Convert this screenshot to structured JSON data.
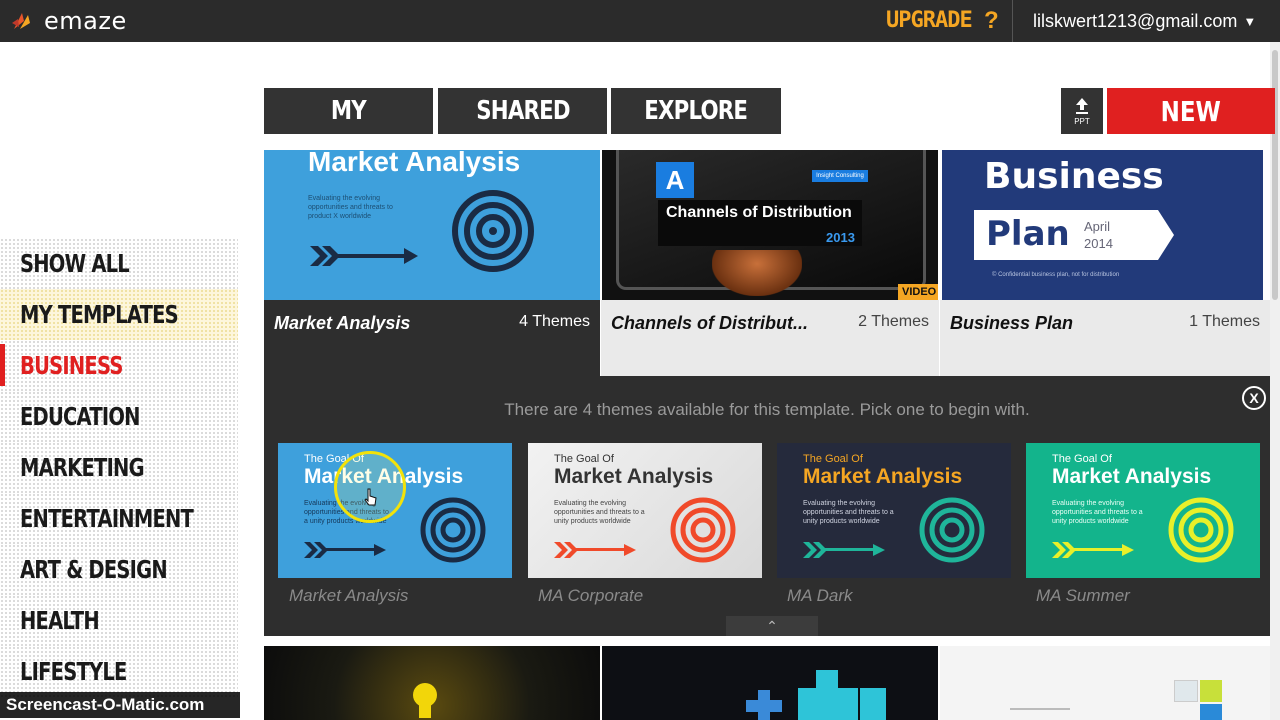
{
  "app": {
    "name": "emaze"
  },
  "topbar": {
    "upgrade_label": "UPGRADE",
    "help_label": "?",
    "user_email": "lilskwert1213@gmail.com",
    "caret": "▼"
  },
  "tabs": [
    {
      "label": "MY"
    },
    {
      "label": "SHARED"
    },
    {
      "label": "EXPLORE"
    }
  ],
  "toolbar": {
    "ppt_label": "PPT",
    "new_label": "NEW"
  },
  "sidebar": {
    "items": [
      {
        "label": "SHOW ALL",
        "state": "normal"
      },
      {
        "label": "MY TEMPLATES",
        "state": "highlight"
      },
      {
        "label": "BUSINESS",
        "state": "active"
      },
      {
        "label": "EDUCATION",
        "state": "normal"
      },
      {
        "label": "MARKETING",
        "state": "normal"
      },
      {
        "label": "ENTERTAINMENT",
        "state": "normal"
      },
      {
        "label": "ART & DESIGN",
        "state": "normal"
      },
      {
        "label": "HEALTH",
        "state": "normal"
      },
      {
        "label": "LIFESTYLE",
        "state": "normal"
      }
    ]
  },
  "templates": [
    {
      "title": "Market Analysis",
      "themes": "4 Themes",
      "thumb_title": "Market Analysis",
      "thumb_sub": "Evaluating the evolving opportunities and threats to product X worldwide"
    },
    {
      "title": "Channels of Distribut...",
      "themes": "2 Themes",
      "badge_letter": "A",
      "thumb_title": "Channels of Distribution",
      "thumb_year": "2013",
      "thumb_tag": "Insight Consulting",
      "video_badge": "VIDEO"
    },
    {
      "title": "Business Plan",
      "themes": "1 Themes",
      "thumb_line1": "Business",
      "thumb_line2": "Plan",
      "thumb_date": "April\n2014",
      "thumb_footer": "© Confidential business plan, not for distribution"
    }
  ],
  "theme_panel": {
    "message": "There are 4 themes available for this template. Pick one to begin with.",
    "close_label": "X",
    "collapse_label": "⌃",
    "themes": [
      {
        "name": "Market Analysis",
        "kicker": "The Goal Of",
        "title": "Market Analysis",
        "sub": "Evaluating the evolving opportunities and threats to a unity products worldwide"
      },
      {
        "name": "MA Corporate",
        "kicker": "The Goal Of",
        "title": "Market Analysis",
        "sub": "Evaluating the evolving opportunities and threats to a unity products worldwide"
      },
      {
        "name": "MA Dark",
        "kicker": "The Goal Of",
        "title": "Market Analysis",
        "sub": "Evaluating the evolving opportunities and threats to a unity products worldwide"
      },
      {
        "name": "MA Summer",
        "kicker": "The Goal Of",
        "title": "Market Analysis",
        "sub": "Evaluating the evolving opportunities and threats to a unity products worldwide"
      }
    ]
  },
  "watermark": "Screencast-O-Matic.com",
  "colors": {
    "accent_red": "#e02020",
    "upgrade_orange": "#f5a623",
    "dark_bar": "#2b2b2b",
    "theme_blue": "#3ea0dc",
    "theme_corporate": "#e8e8e8",
    "theme_dark": "#252a3c",
    "theme_summer": "#13b48c"
  }
}
